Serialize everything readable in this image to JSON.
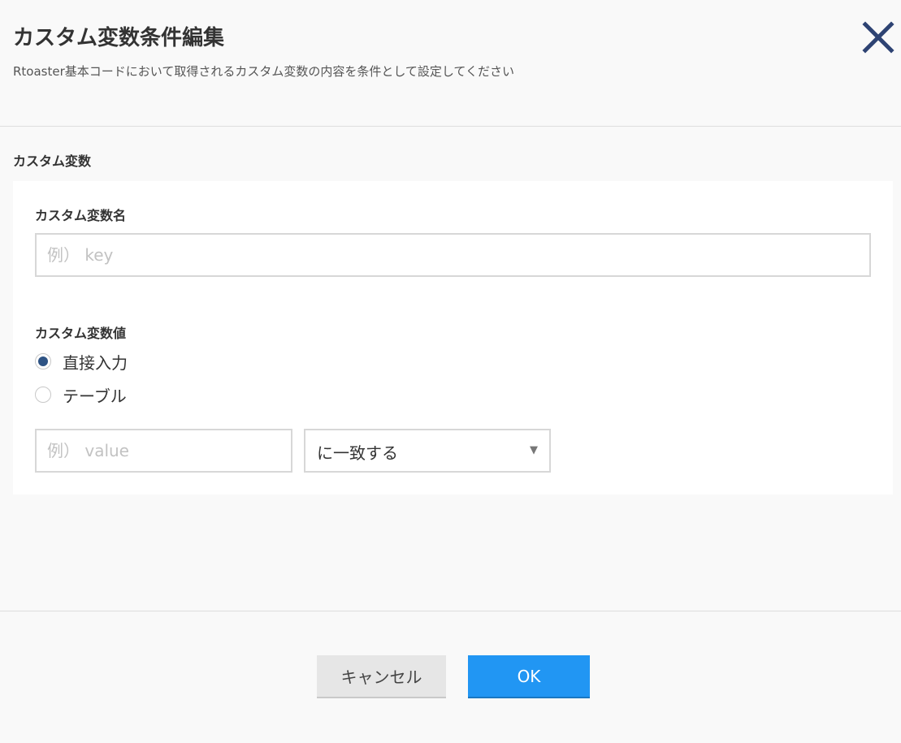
{
  "dialog": {
    "title": "カスタム変数条件編集",
    "description": "Rtoaster基本コードにおいて取得されるカスタム変数の内容を条件として設定してください",
    "close_icon": "close-x-icon",
    "accent_color": "#2e5384"
  },
  "section": {
    "label": "カスタム変数"
  },
  "name_field": {
    "label": "カスタム変数名",
    "value": "",
    "placeholder": "例） key"
  },
  "value_field": {
    "label": "カスタム変数値",
    "options": [
      {
        "label": "直接入力",
        "checked": true
      },
      {
        "label": "テーブル",
        "checked": false
      }
    ],
    "input_value": "",
    "input_placeholder": "例） value",
    "match_select": {
      "selected": "に一致する",
      "arrow_icon": "caret-down-icon"
    }
  },
  "footer": {
    "cancel_label": "キャンセル",
    "ok_label": "OK",
    "ok_color": "#2196f3"
  }
}
